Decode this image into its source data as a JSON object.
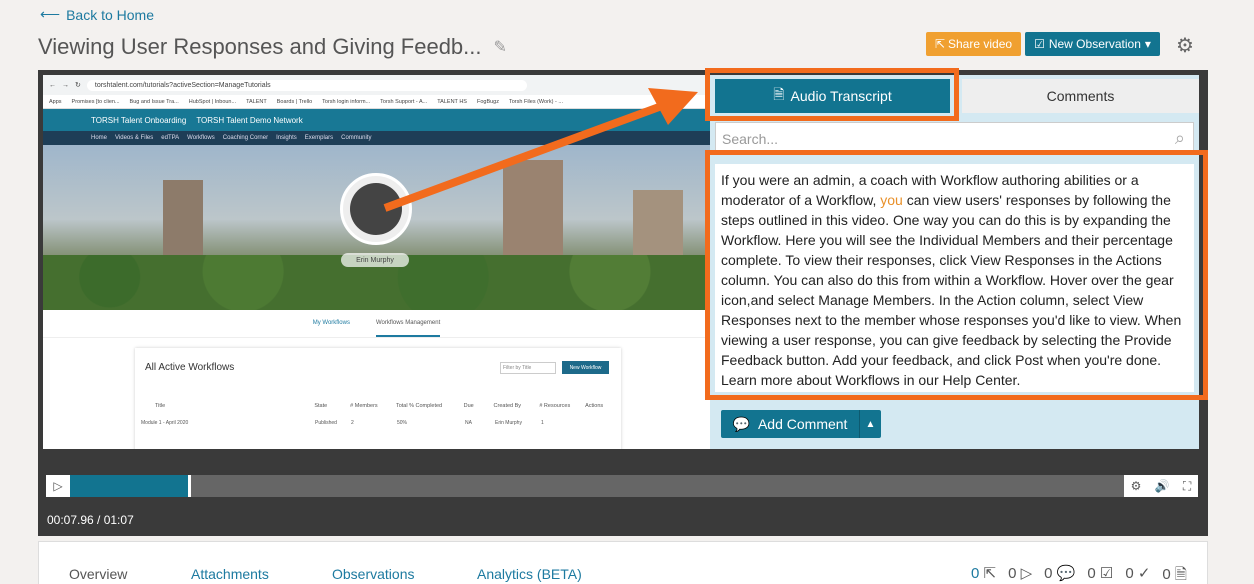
{
  "header": {
    "back_label": "Back to Home",
    "title": "Viewing User Responses and Giving Feedb...",
    "share_label": "Share video",
    "new_obs_label": "New Observation"
  },
  "video": {
    "url": "torshtalent.com/tutorials?activeSection=ManageTutorials",
    "bookmarks": [
      "Apps",
      "Promises [to clien...",
      "Bug and Issue Tra...",
      "HubSpot | Inboun...",
      "TALENT",
      "Boards | Trello",
      "Torsh login inform...",
      "Torsh Support - A...",
      "TALENT HS",
      "FogBugz",
      "Torsh Files (Work) - ..."
    ],
    "site_brand": "TORSH Talent Onboarding",
    "site_network": "TORSH Talent Demo Network",
    "nav": [
      "Home",
      "Videos & Files",
      "edTPA",
      "Workflows",
      "Coaching Corner",
      "Insights",
      "Exemplars",
      "Community"
    ],
    "profile_name": "Erin Murphy",
    "wf_tabs": [
      "My Workflows",
      "Workflows Management"
    ],
    "panel_title": "All Active Workflows",
    "filter_placeholder": "Filter by Title",
    "new_workflow": "New Workflow",
    "columns": [
      "Title",
      "State",
      "# Members",
      "Total % Completed",
      "Due",
      "Created By",
      "# Resources",
      "Actions"
    ],
    "row": [
      "Module 1 - April 2020",
      "Published",
      "2",
      "50%",
      "NA",
      "Erin Murphy",
      "1"
    ]
  },
  "panel": {
    "tab_transcript": "Audio Transcript",
    "tab_comments": "Comments",
    "search_placeholder": "Search...",
    "transcript_pre": "If you were an admin, a coach with Workflow authoring abilities or a moderator of a Workflow, ",
    "transcript_hl": "you",
    "transcript_post": " can view users' responses by following the steps outlined in this video. One way you can do this is by expanding the Workflow. Here you will see the Individual Members and their percentage complete. To view their responses, click View Responses in the Actions column. You can also do this from within a Workflow. Hover over the gear icon,and select Manage Members. In the Action column, select View Responses next to the member whose responses you'd like to view. When viewing a user response, you can give feedback by selecting the Provide Feedback button. Add your feedback, and click Post when you're done. Learn more about Workflows in our Help Center.",
    "add_comment": "Add Comment"
  },
  "player": {
    "time": "00:07.96 / 01:07",
    "progress": 0.112
  },
  "bottom": {
    "tabs": [
      "Overview",
      "Attachments",
      "Observations",
      "Analytics (BETA)"
    ],
    "stats": [
      "0",
      "0",
      "0",
      "0",
      "0",
      "0"
    ]
  },
  "colors": {
    "accent": "#127490",
    "orange": "#f26b1d",
    "share": "#f0a030"
  }
}
